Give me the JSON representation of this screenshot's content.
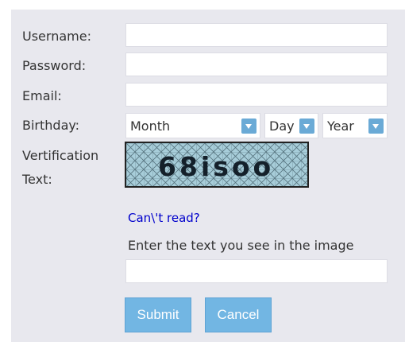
{
  "form": {
    "username_label": "Username:",
    "password_label": "Password:",
    "email_label": "Email:",
    "birthday_label": "Birthday:",
    "verification_label_line1": "Vertification",
    "verification_label_line2": "Text:",
    "username_value": "",
    "password_value": "",
    "email_value": "",
    "verification_value": ""
  },
  "birthday": {
    "month": "Month",
    "day": "Day",
    "year": "Year"
  },
  "captcha": {
    "text": "68isoo"
  },
  "help": {
    "cant_read": "Can\\'t read?",
    "instruction": "Enter the text you see in the image"
  },
  "buttons": {
    "submit": "Submit",
    "cancel": "Cancel"
  },
  "colors": {
    "panel_bg": "#e8e8ee",
    "accent": "#72b6e3",
    "link": "#0000cc",
    "captcha_bg": "#a7cdd9"
  }
}
